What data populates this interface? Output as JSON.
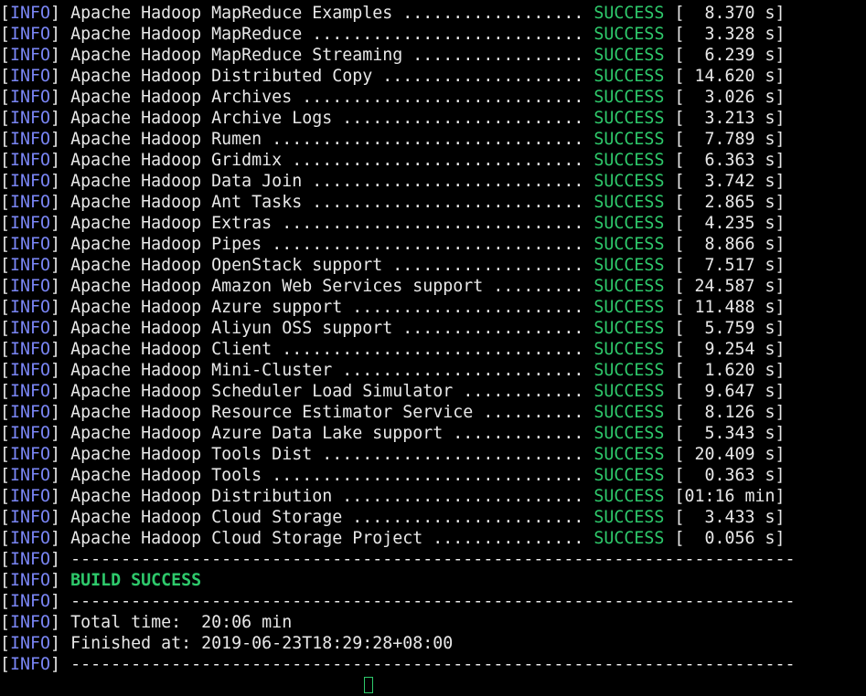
{
  "terminal": {
    "info_tag": "INFO",
    "success_label": "SUCCESS",
    "module_lines": [
      {
        "name": "Apache Hadoop MapReduce Examples",
        "dots": " .................. ",
        "time": "[  8.370 s]"
      },
      {
        "name": "Apache Hadoop MapReduce",
        "dots": " ........................... ",
        "time": "[  3.328 s]"
      },
      {
        "name": "Apache Hadoop MapReduce Streaming",
        "dots": " ................. ",
        "time": "[  6.239 s]"
      },
      {
        "name": "Apache Hadoop Distributed Copy",
        "dots": " .................... ",
        "time": "[ 14.620 s]"
      },
      {
        "name": "Apache Hadoop Archives",
        "dots": " ............................ ",
        "time": "[  3.026 s]"
      },
      {
        "name": "Apache Hadoop Archive Logs",
        "dots": " ........................ ",
        "time": "[  3.213 s]"
      },
      {
        "name": "Apache Hadoop Rumen",
        "dots": " ............................... ",
        "time": "[  7.789 s]"
      },
      {
        "name": "Apache Hadoop Gridmix",
        "dots": " ............................. ",
        "time": "[  6.363 s]"
      },
      {
        "name": "Apache Hadoop Data Join",
        "dots": " ........................... ",
        "time": "[  3.742 s]"
      },
      {
        "name": "Apache Hadoop Ant Tasks",
        "dots": " ........................... ",
        "time": "[  2.865 s]"
      },
      {
        "name": "Apache Hadoop Extras",
        "dots": " .............................. ",
        "time": "[  4.235 s]"
      },
      {
        "name": "Apache Hadoop Pipes",
        "dots": " ............................... ",
        "time": "[  8.866 s]"
      },
      {
        "name": "Apache Hadoop OpenStack support",
        "dots": " ................... ",
        "time": "[  7.517 s]"
      },
      {
        "name": "Apache Hadoop Amazon Web Services support",
        "dots": " ......... ",
        "time": "[ 24.587 s]"
      },
      {
        "name": "Apache Hadoop Azure support",
        "dots": " ....................... ",
        "time": "[ 11.488 s]"
      },
      {
        "name": "Apache Hadoop Aliyun OSS support",
        "dots": " .................. ",
        "time": "[  5.759 s]"
      },
      {
        "name": "Apache Hadoop Client",
        "dots": " .............................. ",
        "time": "[  9.254 s]"
      },
      {
        "name": "Apache Hadoop Mini-Cluster",
        "dots": " ........................ ",
        "time": "[  1.620 s]"
      },
      {
        "name": "Apache Hadoop Scheduler Load Simulator",
        "dots": " ............ ",
        "time": "[  9.647 s]"
      },
      {
        "name": "Apache Hadoop Resource Estimator Service",
        "dots": " .......... ",
        "time": "[  8.126 s]"
      },
      {
        "name": "Apache Hadoop Azure Data Lake support",
        "dots": " ............. ",
        "time": "[  5.343 s]"
      },
      {
        "name": "Apache Hadoop Tools Dist",
        "dots": " .......................... ",
        "time": "[ 20.409 s]"
      },
      {
        "name": "Apache Hadoop Tools",
        "dots": " ............................... ",
        "time": "[  0.363 s]"
      },
      {
        "name": "Apache Hadoop Distribution",
        "dots": " ........................ ",
        "time": "[01:16 min]"
      },
      {
        "name": "Apache Hadoop Cloud Storage",
        "dots": " ....................... ",
        "time": "[  3.433 s]"
      },
      {
        "name": "Apache Hadoop Cloud Storage Project",
        "dots": " ............... ",
        "time": "[  0.056 s]"
      }
    ],
    "separator": "------------------------------------------------------------------------",
    "build_result": "BUILD SUCCESS",
    "total_time": "Total time:  20:06 min",
    "finished_at": "Finished at: 2019-06-23T18:29:28+08:00"
  }
}
